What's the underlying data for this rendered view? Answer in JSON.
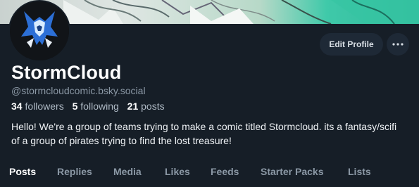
{
  "profile": {
    "display_name": "StormCloud",
    "handle": "@stormcloudcomic.bsky.social",
    "bio": "Hello! We're a group of teams trying to make a comic titled Stormcloud.  its a fantasy/scifi of a group of pirates trying to find the lost treasure!",
    "stats": {
      "followers_count": "34",
      "followers_label": "followers",
      "following_count": "5",
      "following_label": "following",
      "posts_count": "21",
      "posts_label": "posts"
    }
  },
  "actions": {
    "edit_profile_label": "Edit Profile",
    "more_icon": "ellipsis-icon"
  },
  "tabs": [
    {
      "label": "Posts",
      "active": true
    },
    {
      "label": "Replies",
      "active": false
    },
    {
      "label": "Media",
      "active": false
    },
    {
      "label": "Likes",
      "active": false
    },
    {
      "label": "Feeds",
      "active": false
    },
    {
      "label": "Starter Packs",
      "active": false
    },
    {
      "label": "Lists",
      "active": false
    }
  ],
  "colors": {
    "background": "#161e27",
    "button_bg": "#1e2936",
    "muted_text": "#8b98a5",
    "avatar_accent": "#2c6fd6"
  }
}
